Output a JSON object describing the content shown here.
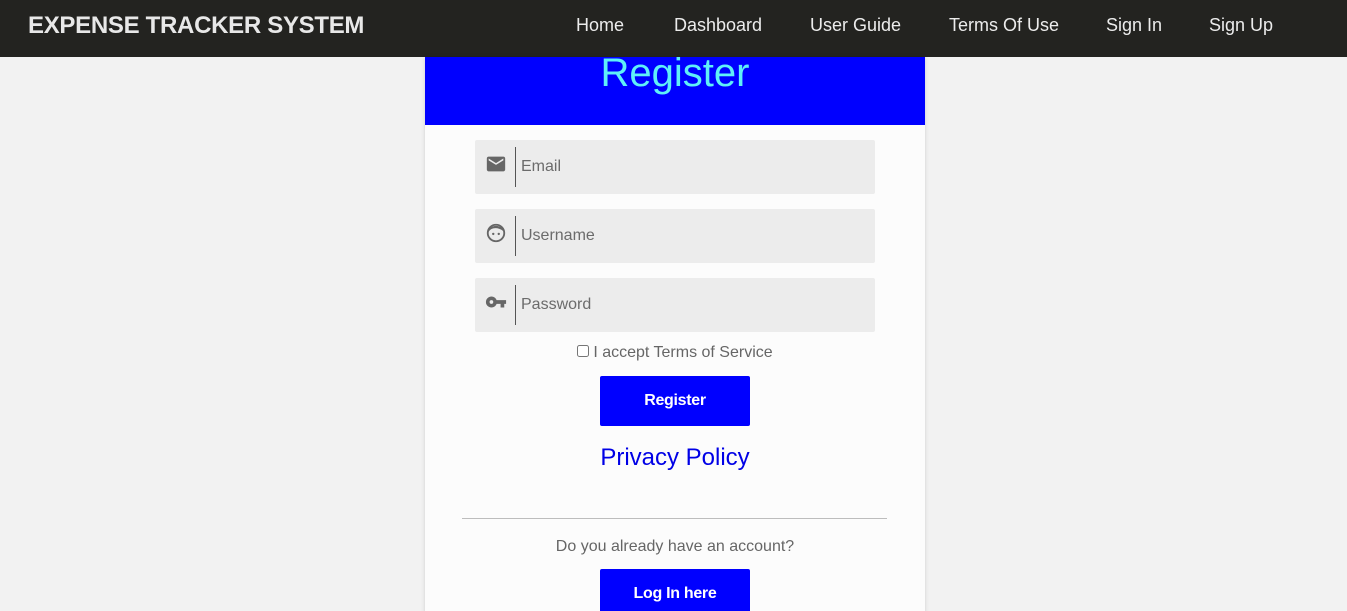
{
  "navbar": {
    "brand": "EXPENSE TRACKER SYSTEM",
    "links": [
      "Home",
      "Dashboard",
      "User Guide",
      "Terms Of Use",
      "Sign In",
      "Sign Up"
    ]
  },
  "form": {
    "title": "Register",
    "email_placeholder": "Email",
    "username_placeholder": "Username",
    "password_placeholder": "Password",
    "terms_label": "I accept Terms of Service",
    "register_button": "Register",
    "privacy_link": "Privacy Policy",
    "account_question": "Do you already have an account?",
    "login_button": "Log In here"
  },
  "icons": {
    "email": "mail-icon",
    "username": "face-icon",
    "password": "key-icon"
  },
  "colors": {
    "navbar": "#232320",
    "accent": "#0000ff",
    "title": "#5ff0f8"
  }
}
